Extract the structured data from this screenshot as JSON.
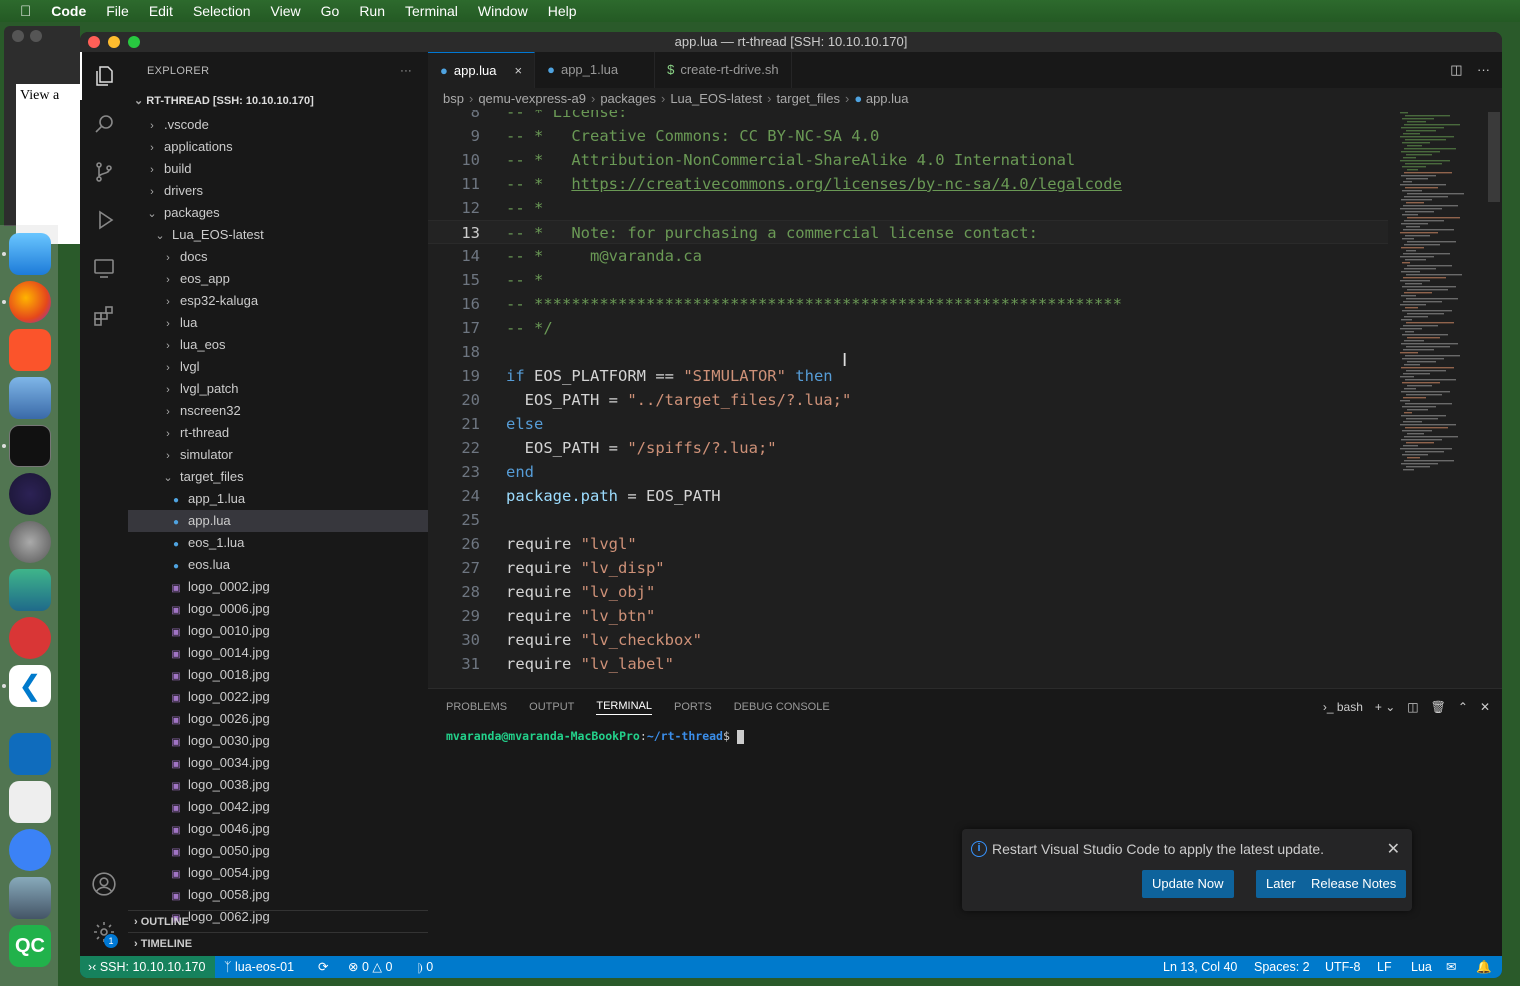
{
  "menubar": {
    "apple": "",
    "app_name": "Code",
    "items": [
      "File",
      "Edit",
      "Selection",
      "View",
      "Go",
      "Run",
      "Terminal",
      "Window",
      "Help"
    ]
  },
  "background_window": {
    "text": "View a"
  },
  "window": {
    "title": "app.lua — rt-thread [SSH: 10.10.10.170]"
  },
  "sidebar": {
    "header": "EXPLORER",
    "more": "···",
    "root": "RT-THREAD [SSH: 10.10.10.170]",
    "tree": [
      {
        "label": ".vscode",
        "depth": 1,
        "kind": "folder"
      },
      {
        "label": "applications",
        "depth": 1,
        "kind": "folder"
      },
      {
        "label": "build",
        "depth": 1,
        "kind": "folder"
      },
      {
        "label": "drivers",
        "depth": 1,
        "kind": "folder"
      },
      {
        "label": "packages",
        "depth": 1,
        "kind": "folder-open"
      },
      {
        "label": "Lua_EOS-latest",
        "depth": 2,
        "kind": "folder-open"
      },
      {
        "label": "docs",
        "depth": 3,
        "kind": "folder"
      },
      {
        "label": "eos_app",
        "depth": 3,
        "kind": "folder"
      },
      {
        "label": "esp32-kaluga",
        "depth": 3,
        "kind": "folder"
      },
      {
        "label": "lua",
        "depth": 3,
        "kind": "folder"
      },
      {
        "label": "lua_eos",
        "depth": 3,
        "kind": "folder"
      },
      {
        "label": "lvgl",
        "depth": 3,
        "kind": "folder"
      },
      {
        "label": "lvgl_patch",
        "depth": 3,
        "kind": "folder"
      },
      {
        "label": "nscreen32",
        "depth": 3,
        "kind": "folder"
      },
      {
        "label": "rt-thread",
        "depth": 3,
        "kind": "folder"
      },
      {
        "label": "simulator",
        "depth": 3,
        "kind": "folder"
      },
      {
        "label": "target_files",
        "depth": 3,
        "kind": "folder-open"
      },
      {
        "label": "app_1.lua",
        "depth": 4,
        "kind": "lua"
      },
      {
        "label": "app.lua",
        "depth": 4,
        "kind": "lua",
        "selected": true
      },
      {
        "label": "eos_1.lua",
        "depth": 4,
        "kind": "lua"
      },
      {
        "label": "eos.lua",
        "depth": 4,
        "kind": "lua"
      },
      {
        "label": "logo_0002.jpg",
        "depth": 4,
        "kind": "img"
      },
      {
        "label": "logo_0006.jpg",
        "depth": 4,
        "kind": "img"
      },
      {
        "label": "logo_0010.jpg",
        "depth": 4,
        "kind": "img"
      },
      {
        "label": "logo_0014.jpg",
        "depth": 4,
        "kind": "img"
      },
      {
        "label": "logo_0018.jpg",
        "depth": 4,
        "kind": "img"
      },
      {
        "label": "logo_0022.jpg",
        "depth": 4,
        "kind": "img"
      },
      {
        "label": "logo_0026.jpg",
        "depth": 4,
        "kind": "img"
      },
      {
        "label": "logo_0030.jpg",
        "depth": 4,
        "kind": "img"
      },
      {
        "label": "logo_0034.jpg",
        "depth": 4,
        "kind": "img"
      },
      {
        "label": "logo_0038.jpg",
        "depth": 4,
        "kind": "img"
      },
      {
        "label": "logo_0042.jpg",
        "depth": 4,
        "kind": "img"
      },
      {
        "label": "logo_0046.jpg",
        "depth": 4,
        "kind": "img"
      },
      {
        "label": "logo_0050.jpg",
        "depth": 4,
        "kind": "img"
      },
      {
        "label": "logo_0054.jpg",
        "depth": 4,
        "kind": "img"
      },
      {
        "label": "logo_0058.jpg",
        "depth": 4,
        "kind": "img"
      },
      {
        "label": "logo_0062.jpg",
        "depth": 4,
        "kind": "img"
      }
    ],
    "outline": "OUTLINE",
    "timeline": "TIMELINE"
  },
  "tabs": [
    {
      "label": "app.lua",
      "icon": "lua-icon",
      "active": true,
      "close": "×"
    },
    {
      "label": "app_1.lua",
      "icon": "lua-icon",
      "active": false
    },
    {
      "label": "create-rt-drive.sh",
      "icon": "shell-icon",
      "active": false
    }
  ],
  "breadcrumb": [
    "bsp",
    "qemu-vexpress-a9",
    "packages",
    "Lua_EOS-latest",
    "target_files",
    "app.lua"
  ],
  "code": {
    "current_line": 13,
    "lines": [
      {
        "n": 8,
        "segs": [
          {
            "t": "-- * License:",
            "c": "cm"
          }
        ]
      },
      {
        "n": 9,
        "segs": [
          {
            "t": "-- *   Creative Commons: CC BY-NC-SA 4.0",
            "c": "cm"
          }
        ]
      },
      {
        "n": 10,
        "segs": [
          {
            "t": "-- *   Attribution-NonCommercial-ShareAlike 4.0 International",
            "c": "cm"
          }
        ]
      },
      {
        "n": 11,
        "segs": [
          {
            "t": "-- *   ",
            "c": "cm"
          },
          {
            "t": "https://creativecommons.org/licenses/by-nc-sa/4.0/legalcode",
            "c": "cm link"
          }
        ]
      },
      {
        "n": 12,
        "segs": [
          {
            "t": "-- *",
            "c": "cm"
          }
        ]
      },
      {
        "n": 13,
        "segs": [
          {
            "t": "-- *   Note: for purchasing a commercial license contact:",
            "c": "cm"
          }
        ]
      },
      {
        "n": 14,
        "segs": [
          {
            "t": "-- *     m@varanda.ca",
            "c": "cm"
          }
        ]
      },
      {
        "n": 15,
        "segs": [
          {
            "t": "-- *",
            "c": "cm"
          }
        ]
      },
      {
        "n": 16,
        "segs": [
          {
            "t": "-- ***************************************************************",
            "c": "cm"
          }
        ]
      },
      {
        "n": 17,
        "segs": [
          {
            "t": "-- */",
            "c": "cm"
          }
        ]
      },
      {
        "n": 18,
        "segs": []
      },
      {
        "n": 19,
        "segs": [
          {
            "t": "if ",
            "c": "kw"
          },
          {
            "t": "EOS_PLATFORM == ",
            "c": "id"
          },
          {
            "t": "\"SIMULATOR\"",
            "c": "st"
          },
          {
            "t": " then",
            "c": "kw"
          }
        ]
      },
      {
        "n": 20,
        "segs": [
          {
            "t": "  EOS_PATH = ",
            "c": "id"
          },
          {
            "t": "\"../target_files/?.lua;\"",
            "c": "st"
          }
        ]
      },
      {
        "n": 21,
        "segs": [
          {
            "t": "else",
            "c": "kw"
          }
        ]
      },
      {
        "n": 22,
        "segs": [
          {
            "t": "  EOS_PATH = ",
            "c": "id"
          },
          {
            "t": "\"/spiffs/?.lua;\"",
            "c": "st"
          }
        ]
      },
      {
        "n": 23,
        "segs": [
          {
            "t": "end",
            "c": "kw"
          }
        ]
      },
      {
        "n": 24,
        "segs": [
          {
            "t": "package.path",
            "c": "prop"
          },
          {
            "t": " = EOS_PATH",
            "c": "id"
          }
        ]
      },
      {
        "n": 25,
        "segs": []
      },
      {
        "n": 26,
        "segs": [
          {
            "t": "require ",
            "c": "id"
          },
          {
            "t": "\"lvgl\"",
            "c": "st"
          }
        ]
      },
      {
        "n": 27,
        "segs": [
          {
            "t": "require ",
            "c": "id"
          },
          {
            "t": "\"lv_disp\"",
            "c": "st"
          }
        ]
      },
      {
        "n": 28,
        "segs": [
          {
            "t": "require ",
            "c": "id"
          },
          {
            "t": "\"lv_obj\"",
            "c": "st"
          }
        ]
      },
      {
        "n": 29,
        "segs": [
          {
            "t": "require ",
            "c": "id"
          },
          {
            "t": "\"lv_btn\"",
            "c": "st"
          }
        ]
      },
      {
        "n": 30,
        "segs": [
          {
            "t": "require ",
            "c": "id"
          },
          {
            "t": "\"lv_checkbox\"",
            "c": "st"
          }
        ]
      },
      {
        "n": 31,
        "segs": [
          {
            "t": "require ",
            "c": "id"
          },
          {
            "t": "\"lv_label\"",
            "c": "st"
          }
        ]
      }
    ]
  },
  "panel": {
    "tabs": [
      "PROBLEMS",
      "OUTPUT",
      "TERMINAL",
      "PORTS",
      "DEBUG CONSOLE"
    ],
    "active_tab": "TERMINAL",
    "shell": "bash",
    "prompt_user": "mvaranda@mvaranda-MacBookPro",
    "prompt_path": "~/rt-thread",
    "prompt_suffix": "$ "
  },
  "notification": {
    "message": "Restart Visual Studio Code to apply the latest update.",
    "buttons": [
      "Update Now",
      "Later",
      "Release Notes"
    ]
  },
  "status": {
    "remote": "SSH: 10.10.10.170",
    "branch": "lua-eos-01",
    "errors": "0",
    "warnings": "0",
    "ports": "0",
    "position": "Ln 13, Col 40",
    "spaces": "Spaces: 2",
    "encoding": "UTF-8",
    "eol": "LF",
    "language": "Lua"
  },
  "settings_badge": "1",
  "colors": {
    "accent": "#007acc",
    "remote": "#16825d",
    "button": "#0e639c"
  }
}
